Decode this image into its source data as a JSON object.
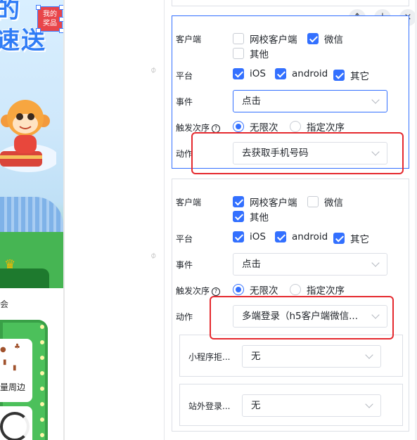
{
  "canvas": {
    "title_line1": "的",
    "title_line2": "速送",
    "badge_line1": "我的",
    "badge_line2": "奖品",
    "card_text": "会",
    "prize_text": "量周边"
  },
  "controls": {
    "up_symbol": "↑",
    "down_symbol": "↓",
    "close_symbol": "×"
  },
  "card1": {
    "client_label": "客户端",
    "client_options": [
      {
        "label": "网校客户端",
        "checked": false
      },
      {
        "label": "微信",
        "checked": true
      },
      {
        "label": "其他",
        "checked": false
      }
    ],
    "platform_label": "平台",
    "platform_options": [
      {
        "label": "iOS",
        "checked": true
      },
      {
        "label": "android",
        "checked": true
      },
      {
        "label": "其它",
        "checked": true
      }
    ],
    "event_label": "事件",
    "event_value": "点击",
    "trigger_label": "触发次序",
    "trigger_options": [
      {
        "label": "无限次",
        "selected": true
      },
      {
        "label": "指定次序",
        "selected": false
      }
    ],
    "action_label": "动作",
    "action_value": "去获取手机号码"
  },
  "card2": {
    "client_label": "客户端",
    "client_options": [
      {
        "label": "网校客户端",
        "checked": true
      },
      {
        "label": "微信",
        "checked": false
      },
      {
        "label": "其他",
        "checked": true
      }
    ],
    "platform_label": "平台",
    "platform_options": [
      {
        "label": "iOS",
        "checked": true
      },
      {
        "label": "android",
        "checked": true
      },
      {
        "label": "其它",
        "checked": true
      }
    ],
    "event_label": "事件",
    "event_value": "点击",
    "trigger_label": "触发次序",
    "trigger_options": [
      {
        "label": "无限次",
        "selected": true
      },
      {
        "label": "指定次序",
        "selected": false
      }
    ],
    "action_label": "动作",
    "action_value": "多端登录（h5客户端微信...",
    "sub1_label": "小程序拒...",
    "sub1_value": "无",
    "sub2_label": "站外登录...",
    "sub2_value": "无"
  },
  "colors": {
    "accent": "#3370ff",
    "highlight": "#e5292e"
  }
}
